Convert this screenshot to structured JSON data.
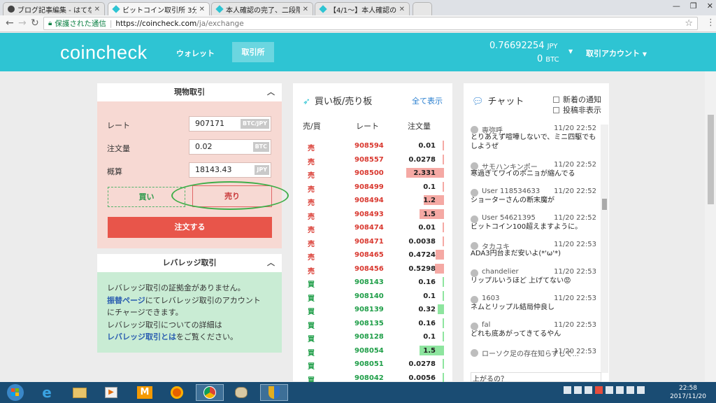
{
  "browser": {
    "tabs": [
      {
        "label": "ブログ記事編集 - はてな"
      },
      {
        "label": "ビットコイン取引所 3分"
      },
      {
        "label": "本人確認の完了、二段階"
      },
      {
        "label": "【4/1〜】本人確認の状"
      }
    ],
    "url_secure_label": "保護された通信",
    "url_host": "https://coincheck.com",
    "url_path": "/ja/exchange"
  },
  "header": {
    "logo": "coincheck",
    "nav_wallet": "ウォレット",
    "nav_exchange": "取引所",
    "balance_jpy": "0.76692254",
    "balance_jpy_unit": "JPY",
    "balance_btc": "0",
    "balance_btc_unit": "BTC",
    "account_menu": "取引アカウント",
    "accent_color": "#2ec4d3"
  },
  "trade": {
    "title": "現物取引",
    "rate_label": "レート",
    "rate_value": "907171",
    "rate_unit": "BTC/JPY",
    "amount_label": "注文量",
    "amount_value": "0.02",
    "amount_unit": "BTC",
    "total_label": "概算",
    "total_value": "18143.43",
    "total_unit": "JPY",
    "buy_label": "買い",
    "sell_label": "売り",
    "order_label": "注文する"
  },
  "leverage": {
    "title": "レバレッジ取引",
    "line1": "レバレッジ取引の証拠金がありません。",
    "link1": "振替ページ",
    "line2": "にてレバレッジ取引のアカウント",
    "line3": "にチャージできます。",
    "line4": "レバレッジ取引についての詳細は",
    "link2": "レバレッジ取引とは",
    "line5": "をご覧ください。"
  },
  "orderbook": {
    "title": "買い板/売り板",
    "show_all": "全て表示",
    "col_side": "売/買",
    "col_rate": "レート",
    "col_amount": "注文量",
    "rows": [
      {
        "side": "売",
        "rate": "908594",
        "amount": "0.01",
        "type": "sell",
        "fill": 0.0
      },
      {
        "side": "売",
        "rate": "908557",
        "amount": "0.0278",
        "type": "sell",
        "fill": 0.0
      },
      {
        "side": "売",
        "rate": "908500",
        "amount": "2.331",
        "type": "sell",
        "fill": 1.0
      },
      {
        "side": "売",
        "rate": "908499",
        "amount": "0.1",
        "type": "sell",
        "fill": 0.0
      },
      {
        "side": "売",
        "rate": "908494",
        "amount": "1.2",
        "type": "sell",
        "fill": 0.52
      },
      {
        "side": "売",
        "rate": "908493",
        "amount": "1.5",
        "type": "sell",
        "fill": 0.64
      },
      {
        "side": "売",
        "rate": "908474",
        "amount": "0.01",
        "type": "sell",
        "fill": 0.0
      },
      {
        "side": "売",
        "rate": "908471",
        "amount": "0.0038",
        "type": "sell",
        "fill": 0.0
      },
      {
        "side": "売",
        "rate": "908465",
        "amount": "0.4724",
        "type": "sell",
        "fill": 0.2
      },
      {
        "side": "売",
        "rate": "908456",
        "amount": "0.5298",
        "type": "sell",
        "fill": 0.22
      },
      {
        "side": "買",
        "rate": "908143",
        "amount": "0.16",
        "type": "buy",
        "fill": 0.0
      },
      {
        "side": "買",
        "rate": "908140",
        "amount": "0.1",
        "type": "buy",
        "fill": 0.0
      },
      {
        "side": "買",
        "rate": "908139",
        "amount": "0.32",
        "type": "buy",
        "fill": 0.14
      },
      {
        "side": "買",
        "rate": "908135",
        "amount": "0.16",
        "type": "buy",
        "fill": 0.0
      },
      {
        "side": "買",
        "rate": "908128",
        "amount": "0.1",
        "type": "buy",
        "fill": 0.0
      },
      {
        "side": "買",
        "rate": "908054",
        "amount": "1.5",
        "type": "buy",
        "fill": 0.64
      },
      {
        "side": "買",
        "rate": "908051",
        "amount": "0.0278",
        "type": "buy",
        "fill": 0.0
      },
      {
        "side": "買",
        "rate": "908042",
        "amount": "0.0056",
        "type": "buy",
        "fill": 0.0
      }
    ]
  },
  "chat": {
    "title": "チャット",
    "notify_label": "新着の通知",
    "hide_label": "投稿非表示",
    "messages": [
      {
        "user": "専弥呼",
        "time": "11/20 22:52",
        "text": "とりあえず喧嘩しないで、ミニ四駆でもしようぜ"
      },
      {
        "user": "サモハンキンポー",
        "time": "11/20 22:52",
        "text": "寒過ぎてワイのポニョが縮んでる"
      },
      {
        "user": "User 118534633",
        "time": "11/20 22:52",
        "text": "ショーターさんの断末魔が"
      },
      {
        "user": "User 54621395",
        "time": "11/20 22:52",
        "text": "ビットコイン100超えますように。"
      },
      {
        "user": "タカユキ",
        "time": "11/20 22:53",
        "text": "ADA3円台まだ安いよ(*'ω'*)"
      },
      {
        "user": "chandelier",
        "time": "11/20 22:53",
        "text": "リップルいうほど 上げてない😡"
      },
      {
        "user": "1603",
        "time": "11/20 22:53",
        "text": "ネムとリップル結局仲良し"
      },
      {
        "user": "fal",
        "time": "11/20 22:53",
        "text": "どれも底あがってきてるやん"
      },
      {
        "user": "ローソク足の存在知らずして...",
        "time": "11/20 22:53",
        "text": ""
      }
    ],
    "input_value": "上がるの？"
  },
  "taskbar": {
    "clock_time": "22:58",
    "clock_date": "2017/11/20"
  }
}
